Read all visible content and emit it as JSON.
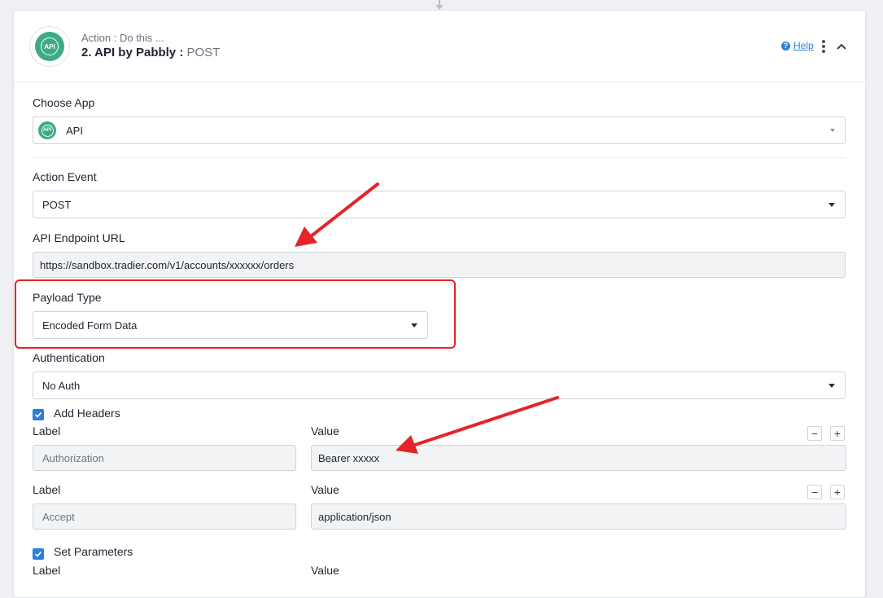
{
  "header": {
    "subtitle": "Action : Do this ...",
    "title": "2. API by Pabbly :",
    "method": "POST",
    "help_label": "Help",
    "app_badge_text": "API"
  },
  "choose_app": {
    "label": "Choose App",
    "value": "API",
    "icon": "api-icon"
  },
  "action_event": {
    "label": "Action Event",
    "value": "POST"
  },
  "endpoint": {
    "label": "API Endpoint URL",
    "value": "https://sandbox.tradier.com/v1/accounts/xxxxxx/orders"
  },
  "payload": {
    "label": "Payload Type",
    "value": "Encoded Form Data"
  },
  "auth": {
    "label": "Authentication",
    "value": "No Auth"
  },
  "headers": {
    "checkbox_label": "Add Headers",
    "rows": [
      {
        "label_title": "Label",
        "value_title": "Value",
        "label_value": "Authorization",
        "value_value": "Bearer xxxxx"
      },
      {
        "label_title": "Label",
        "value_title": "Value",
        "label_value": "Accept",
        "value_value": "application/json"
      }
    ],
    "remove_symbol": "−",
    "add_symbol": "+"
  },
  "params": {
    "checkbox_label": "Set Parameters",
    "label_title": "Label",
    "value_title": "Value"
  },
  "colors": {
    "accent": "#2b7dde",
    "brand": "#3dab84",
    "annotation": "#e5232a"
  }
}
